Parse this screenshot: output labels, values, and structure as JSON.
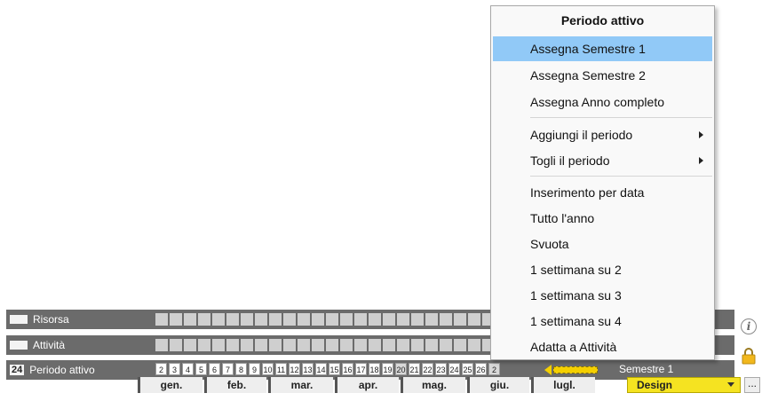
{
  "rows": {
    "risorsa": {
      "label": "Risorsa"
    },
    "attivita": {
      "label": "Attività"
    },
    "periodo": {
      "badge": "24",
      "label": "Periodo attivo",
      "semester_label": "Semestre 1"
    }
  },
  "weeks": [
    "2",
    "3",
    "4",
    "5",
    "6",
    "7",
    "8",
    "9",
    "10",
    "11",
    "12",
    "13",
    "14",
    "15",
    "16",
    "17",
    "18",
    "19",
    "20",
    "21",
    "22",
    "23",
    "24",
    "25",
    "26",
    "2"
  ],
  "months": [
    "gen.",
    "feb.",
    "mar.",
    "apr.",
    "mag.",
    "giu.",
    "lugl."
  ],
  "design_select": {
    "value": "Design"
  },
  "more_button": "...",
  "info_icon_glyph": "i",
  "menu": {
    "title": "Periodo attivo",
    "items": [
      "Assegna Semestre 1",
      "Assegna Semestre 2",
      "Assegna Anno completo",
      "Aggiungi il periodo",
      "Togli il periodo",
      "Inserimento per data",
      "Tutto l'anno",
      "Svuota",
      "1 settimana su 2",
      "1 settimana su 3",
      "1 settimana su 4",
      "Adatta a Attività"
    ]
  },
  "colors": {
    "highlight": "#91c9f7",
    "accent_yellow": "#f5e321",
    "panel_gray": "#6b6b6b"
  },
  "icons": {
    "info": "info-icon",
    "lock": "lock-icon",
    "submenu": "chevron-right-icon"
  }
}
